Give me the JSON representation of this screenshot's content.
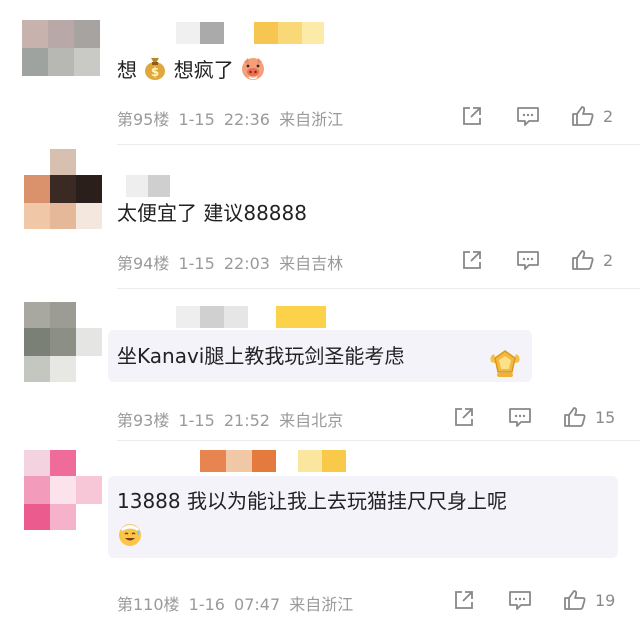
{
  "comments": [
    {
      "text_parts": [
        "想",
        "想疯了"
      ],
      "floor": "第95楼",
      "date": "1-15",
      "time": "22:36",
      "location": "来自浙江",
      "likes": "2"
    },
    {
      "text_parts": [
        "太便宜了 建议88888"
      ],
      "floor": "第94楼",
      "date": "1-15",
      "time": "22:03",
      "location": "来自吉林",
      "likes": "2"
    },
    {
      "text_parts": [
        "坐Kanavi腿上教我玩剑圣能考虑"
      ],
      "floor": "第93楼",
      "date": "1-15",
      "time": "21:52",
      "location": "来自北京",
      "likes": "15"
    },
    {
      "text_parts": [
        "13888 我以为能让我上去玩猫挂尺尺身上呢"
      ],
      "floor": "第110楼",
      "date": "1-16",
      "time": "07:47",
      "location": "来自浙江",
      "likes": "19"
    }
  ],
  "icons": {
    "share": "share-icon",
    "reply": "comment-icon",
    "like": "thumbs-up-icon",
    "money": "money-bag-emoji",
    "pig": "pig-face-emoji",
    "badge": "gold-badge-icon",
    "sweat": "sweat-smile-emoji"
  },
  "colors": {
    "meta": "#9a9a9a",
    "bubble": "#f5f3fa",
    "icon": "#888888"
  }
}
